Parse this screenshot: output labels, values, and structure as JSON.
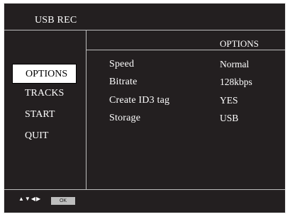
{
  "header": {
    "title": "USB REC"
  },
  "menu": {
    "items": [
      {
        "label": "OPTIONS",
        "selected": true
      },
      {
        "label": "TRACKS",
        "selected": false
      },
      {
        "label": "START",
        "selected": false
      },
      {
        "label": "QUIT",
        "selected": false
      }
    ]
  },
  "options": {
    "section_title": "OPTIONS",
    "rows": [
      {
        "label": "Speed",
        "value": "Normal"
      },
      {
        "label": "Bitrate",
        "value": "128kbps"
      },
      {
        "label": "Create ID3 tag",
        "value": "YES"
      },
      {
        "label": "Storage",
        "value": "USB"
      }
    ]
  },
  "footer": {
    "nav_icons": [
      "up-triangle-icon",
      "down-triangle-icon",
      "left-triangle-icon",
      "right-triangle-icon"
    ],
    "ok_label": "OK"
  },
  "colors": {
    "background": "#231f20",
    "divider": "#bdbdbd",
    "selected_bg": "#ffffff"
  }
}
